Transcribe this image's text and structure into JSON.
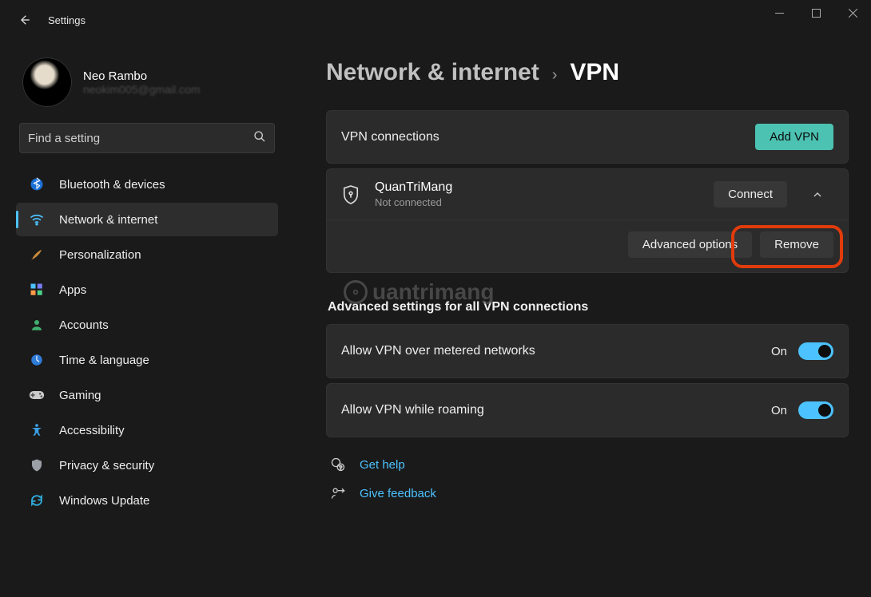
{
  "window": {
    "title": "Settings"
  },
  "profile": {
    "name": "Neo Rambo",
    "email": "neokim005@gmail.com"
  },
  "search": {
    "placeholder": "Find a setting"
  },
  "sidebar": {
    "items": [
      {
        "icon": "bluetooth-icon",
        "label": "Bluetooth & devices"
      },
      {
        "icon": "wifi-icon",
        "label": "Network & internet"
      },
      {
        "icon": "brush-icon",
        "label": "Personalization"
      },
      {
        "icon": "apps-icon",
        "label": "Apps"
      },
      {
        "icon": "person-icon",
        "label": "Accounts"
      },
      {
        "icon": "globe-clock-icon",
        "label": "Time & language"
      },
      {
        "icon": "gamepad-icon",
        "label": "Gaming"
      },
      {
        "icon": "accessibility-icon",
        "label": "Accessibility"
      },
      {
        "icon": "shield-icon",
        "label": "Privacy & security"
      },
      {
        "icon": "update-icon",
        "label": "Windows Update"
      }
    ],
    "active_index": 1
  },
  "breadcrumb": {
    "parent": "Network & internet",
    "current": "VPN"
  },
  "vpn_connections": {
    "header": "VPN connections",
    "add_button": "Add VPN",
    "items": [
      {
        "name": "QuanTriMang",
        "status": "Not connected",
        "connect_label": "Connect",
        "advanced_label": "Advanced options",
        "remove_label": "Remove"
      }
    ]
  },
  "advanced_section": {
    "title": "Advanced settings for all VPN connections",
    "rows": [
      {
        "label": "Allow VPN over metered networks",
        "state": "On",
        "value": true
      },
      {
        "label": "Allow VPN while roaming",
        "state": "On",
        "value": true
      }
    ]
  },
  "footer_links": {
    "help": "Get help",
    "feedback": "Give feedback"
  },
  "watermark": "uantrimang"
}
